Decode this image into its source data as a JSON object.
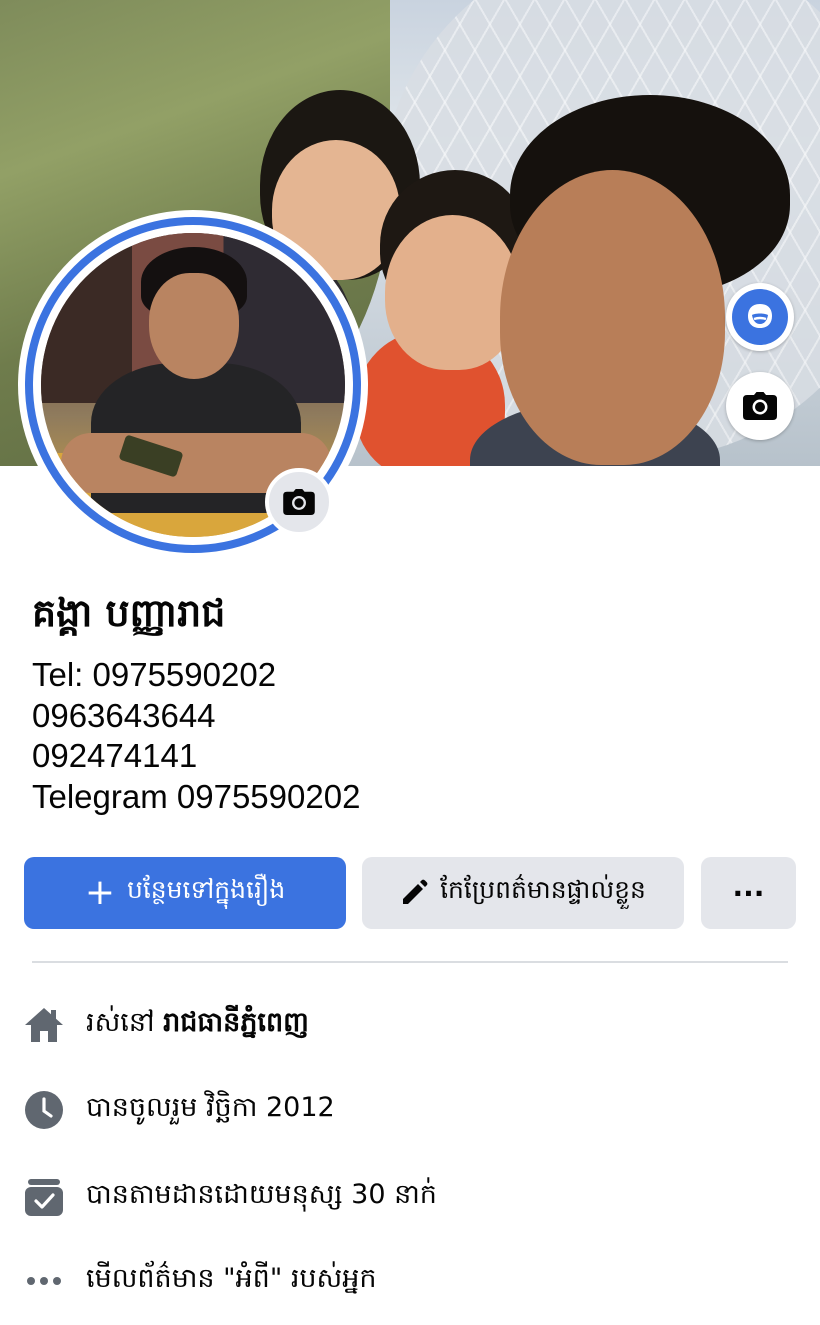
{
  "profile": {
    "name": "គង្គា បញ្ញារាជ",
    "bio_lines": [
      "Tel: 0975590202",
      "0963643644",
      "092474141",
      "Telegram 0975590202"
    ]
  },
  "icons": {
    "avatar_frame": "avatar-icon",
    "cover_camera": "camera-icon",
    "profile_camera": "camera-icon",
    "add_story": "plus-icon",
    "edit": "pencil-icon",
    "more": "more-horizontal-icon",
    "home": "home-icon",
    "clock": "clock-icon",
    "followers": "rss-feed-icon",
    "about": "more-horizontal-icon"
  },
  "actions": {
    "add_story_label": "បន្ថែមទៅក្នុងរឿង",
    "edit_profile_label": "កែប្រែពត៌មានផ្ទាល់ខ្លួន",
    "more_label": "···"
  },
  "details": {
    "lives_prefix": "រស់នៅ",
    "lives_city": "រាជធានីភ្នំពេញ",
    "joined": "បានចូលរួម វិច្ឆិកា 2012",
    "followers": "បានតាមដានដោយមនុស្ស 30 នាក់",
    "about": "មើលព័ត៌មាន \"អំពី\" របស់អ្នក"
  },
  "colors": {
    "accent": "#3b73e0",
    "button_gray": "#e4e6eb",
    "icon_gray": "#606770",
    "divider": "#dadde1"
  }
}
